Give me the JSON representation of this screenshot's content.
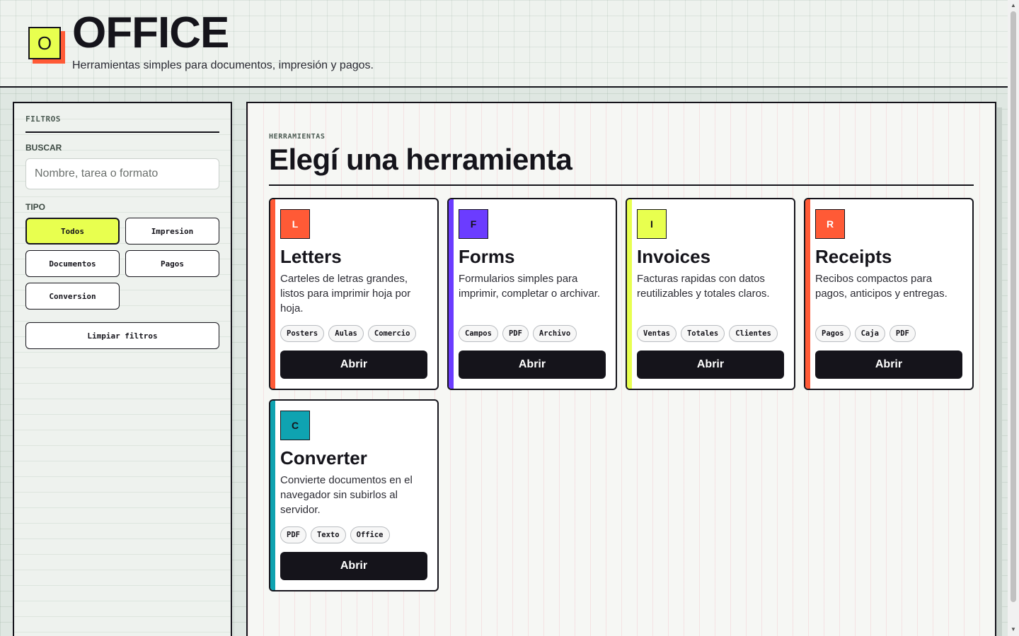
{
  "header": {
    "logo_letter": "O",
    "title": "OFFICE",
    "subtitle": "Herramientas simples para documentos, impresión y pagos."
  },
  "sidebar": {
    "heading": "FILTROS",
    "search_label": "BUSCAR",
    "search_placeholder": "Nombre, tarea o formato",
    "type_label": "TIPO",
    "chips": [
      {
        "label": "Todos",
        "active": true
      },
      {
        "label": "Impresion",
        "active": false
      },
      {
        "label": "Documentos",
        "active": false
      },
      {
        "label": "Pagos",
        "active": false
      },
      {
        "label": "Conversion",
        "active": false
      }
    ],
    "clear_label": "Limpiar filtros"
  },
  "main": {
    "eyebrow": "HERRAMIENTAS",
    "title": "Elegí una herramienta",
    "cards": [
      {
        "badge": "L",
        "title": "Letters",
        "description": "Carteles de letras grandes, listos para imprimir hoja por hoja.",
        "tags": [
          "Posters",
          "Aulas",
          "Comercio"
        ],
        "button": "Abrir",
        "accent": "#ff5a36",
        "badge_text_color": "#ffffff"
      },
      {
        "badge": "F",
        "title": "Forms",
        "description": "Formularios simples para imprimir, completar o archivar.",
        "tags": [
          "Campos",
          "PDF",
          "Archivo"
        ],
        "button": "Abrir",
        "accent": "#6b3cff",
        "badge_text_color": "#15141b"
      },
      {
        "badge": "I",
        "title": "Invoices",
        "description": "Facturas rapidas con datos reutilizables y totales claros.",
        "tags": [
          "Ventas",
          "Totales",
          "Clientes"
        ],
        "button": "Abrir",
        "accent": "#e8ff4f",
        "badge_text_color": "#15141b"
      },
      {
        "badge": "R",
        "title": "Receipts",
        "description": "Recibos compactos para pagos, anticipos y entregas.",
        "tags": [
          "Pagos",
          "Caja",
          "PDF"
        ],
        "button": "Abrir",
        "accent": "#ff5a36",
        "badge_text_color": "#ffffff"
      },
      {
        "badge": "C",
        "title": "Converter",
        "description": "Convierte documentos en el navegador sin subirlos al servidor.",
        "tags": [
          "PDF",
          "Texto",
          "Office"
        ],
        "button": "Abrir",
        "accent": "#0fa3b1",
        "badge_text_color": "#15141b"
      }
    ]
  }
}
